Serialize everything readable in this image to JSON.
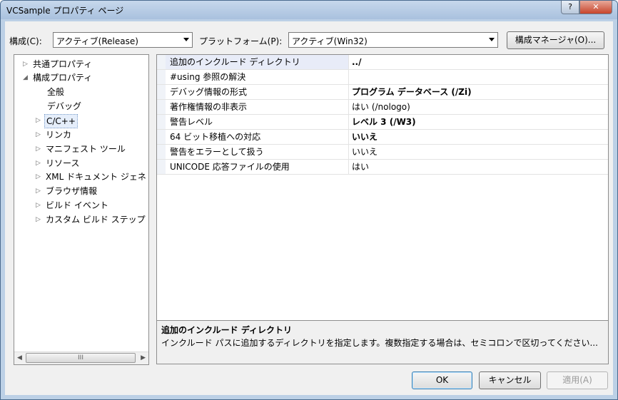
{
  "window": {
    "title": "VCSample プロパティ ページ",
    "help_label": "?",
    "close_label": "✕"
  },
  "top": {
    "config_label": "構成(C):",
    "config_value": "アクティブ(Release)",
    "platform_label": "プラットフォーム(P):",
    "platform_value": "アクティブ(Win32)",
    "manager_button": "構成マネージャ(O)..."
  },
  "tree": {
    "common": "共通プロパティ",
    "config": "構成プロパティ",
    "general": "全般",
    "debug": "デバッグ",
    "cpp": "C/C++",
    "linker": "リンカ",
    "manifest": "マニフェスト ツール",
    "resource": "リソース",
    "xmldoc": "XML ドキュメント ジェネ",
    "browse": "ブラウザ情報",
    "build_events": "ビルド イベント",
    "custom_build": "カスタム ビルド ステップ",
    "scroll_grip": "III"
  },
  "properties": [
    {
      "name": "追加のインクルード ディレクトリ",
      "value": "../"
    },
    {
      "name": "#using 参照の解決",
      "value": ""
    },
    {
      "name": "デバッグ情報の形式",
      "value": "プログラム データベース (/Zi)"
    },
    {
      "name": "著作権情報の非表示",
      "value": "はい (/nologo)"
    },
    {
      "name": "警告レベル",
      "value": "レベル 3 (/W3)"
    },
    {
      "name": "64 ビット移植への対応",
      "value": "いいえ"
    },
    {
      "name": "警告をエラーとして扱う",
      "value": "いいえ"
    },
    {
      "name": "UNICODE 応答ファイルの使用",
      "value": "はい"
    }
  ],
  "description": {
    "title": "追加のインクルード ディレクトリ",
    "text": "インクルード パスに追加するディレクトリを指定します。複数指定する場合は、セミコロンで区切ってください..."
  },
  "buttons": {
    "ok": "OK",
    "cancel": "キャンセル",
    "apply": "適用(A)"
  }
}
